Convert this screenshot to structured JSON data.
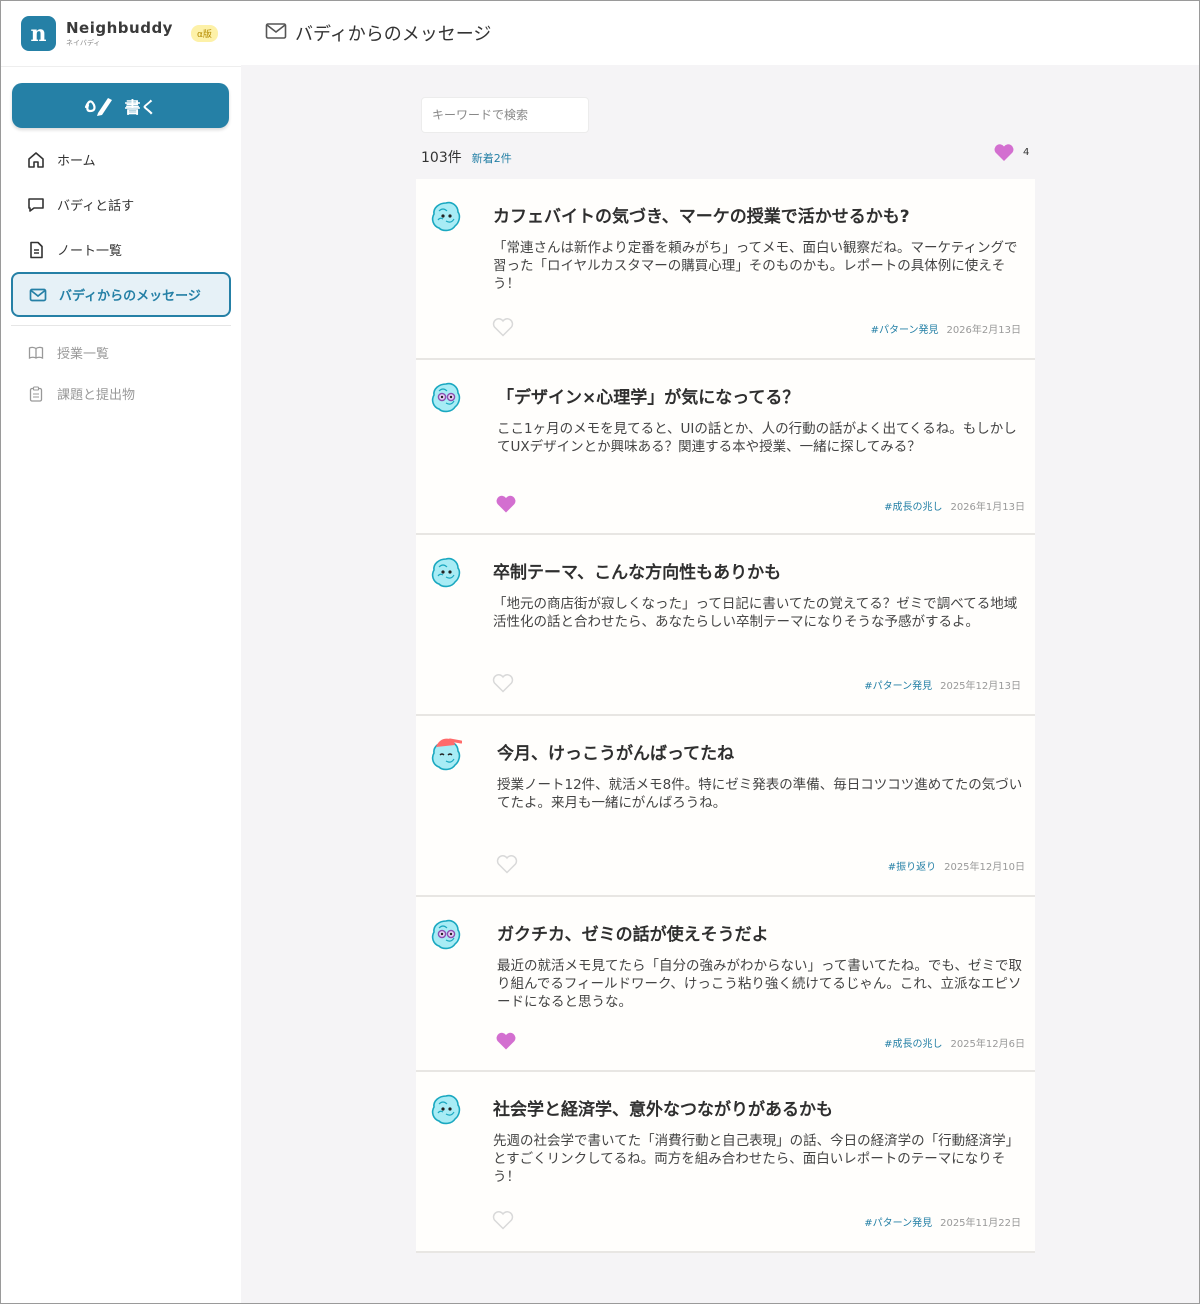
{
  "brand": {
    "name": "Neighbuddy",
    "sub": "ネイバディ",
    "badge": "α版",
    "logo_glyph": "n"
  },
  "sidebar": {
    "write_label": "書く",
    "items": [
      {
        "label": "ホーム",
        "icon": "home-icon"
      },
      {
        "label": "バディと話す",
        "icon": "chat-bubble-icon"
      },
      {
        "label": "ノート一覧",
        "icon": "document-icon"
      },
      {
        "label": "バディからのメッセージ",
        "icon": "mail-icon",
        "active": true
      }
    ],
    "secondary": [
      {
        "label": "授業一覧",
        "icon": "book-icon"
      },
      {
        "label": "課題と提出物",
        "icon": "clipboard-icon"
      }
    ]
  },
  "header": {
    "title": "バディからのメッセージ",
    "icon": "mail-icon"
  },
  "search": {
    "placeholder": "キーワードで検索",
    "value": ""
  },
  "summary": {
    "count": "103件",
    "new": "新着2件",
    "liked_count": "4"
  },
  "colors": {
    "accent": "#2580a6",
    "heart_filled": "#d36fd0",
    "heart_empty": "#d9d9d9",
    "tag": "#2580a6"
  },
  "messages": [
    {
      "title": "カフェバイトの気づき、マーケの授業で活かせるかも?",
      "body": "「常連さんは新作より定番を頼みがち」ってメモ、面白い観察だね。マーケティングで習った「ロイヤルカスタマーの購買心理」そのものかも。レポートの具体例に使えそう！",
      "tag": "#パターン発見",
      "date": "2026年2月13日",
      "liked": false
    },
    {
      "title": "「デザイン×心理学」が気になってる？",
      "body": "ここ1ヶ月のメモを見てると、UIの話とか、人の行動の話がよく出てくるね。もしかしてUXデザインとか興味ある？関連する本や授業、一緒に探してみる？",
      "tag": "#成長の兆し",
      "date": "2026年1月13日",
      "liked": true
    },
    {
      "title": "卒制テーマ、こんな方向性もありかも",
      "body": "「地元の商店街が寂しくなった」って日記に書いてたの覚えてる？ゼミで調べてる地域活性化の話と合わせたら、あなたらしい卒制テーマになりそうな予感がするよ。",
      "tag": "#パターン発見",
      "date": "2025年12月13日",
      "liked": false
    },
    {
      "title": "今月、けっこうがんばってたね",
      "body": "授業ノート12件、就活メモ8件。特にゼミ発表の準備、毎日コツコツ進めてたの気づいてたよ。来月も一緒にがんばろうね。",
      "tag": "#振り返り",
      "date": "2025年12月10日",
      "liked": false
    },
    {
      "title": "ガクチカ、ゼミの話が使えそうだよ",
      "body": "最近の就活メモ見てたら「自分の強みがわからない」って書いてたね。でも、ゼミで取り組んでるフィールドワーク、けっこう粘り強く続けてるじゃん。これ、立派なエピソードになると思うな。",
      "tag": "#成長の兆し",
      "date": "2025年12月6日",
      "liked": true
    },
    {
      "title": "社会学と経済学、意外なつながりがあるかも",
      "body": "先週の社会学で書いてた「消費行動と自己表現」の話、今日の経済学の「行動経済学」とすごくリンクしてるね。両方を組み合わせたら、面白いレポートのテーマになりそう！",
      "tag": "#パターン発見",
      "date": "2025年11月22日",
      "liked": false
    }
  ]
}
